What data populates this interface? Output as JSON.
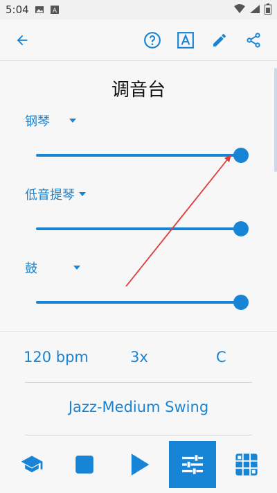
{
  "status": {
    "time": "5:04"
  },
  "app": {
    "back_icon": "arrow-left-icon",
    "actions": [
      "help-icon",
      "text-format-icon",
      "edit-icon",
      "share-icon"
    ]
  },
  "mixer": {
    "title": "调音台",
    "channels": [
      {
        "label": "钢琴",
        "level": 1.0
      },
      {
        "label": "低音提琴",
        "level": 1.0
      },
      {
        "label": "鼓",
        "level": 1.0
      }
    ]
  },
  "settings": {
    "tempo": "120 bpm",
    "repeats": "3x",
    "key": "C",
    "style": "Jazz-Medium Swing"
  },
  "bottom_nav": {
    "items": [
      "school-icon",
      "stop-icon",
      "play-icon",
      "mixer-icon",
      "grid-icon"
    ],
    "active_index": 3
  },
  "colors": {
    "accent": "#1784d5",
    "annotation_arrow": "#e03a3a"
  }
}
